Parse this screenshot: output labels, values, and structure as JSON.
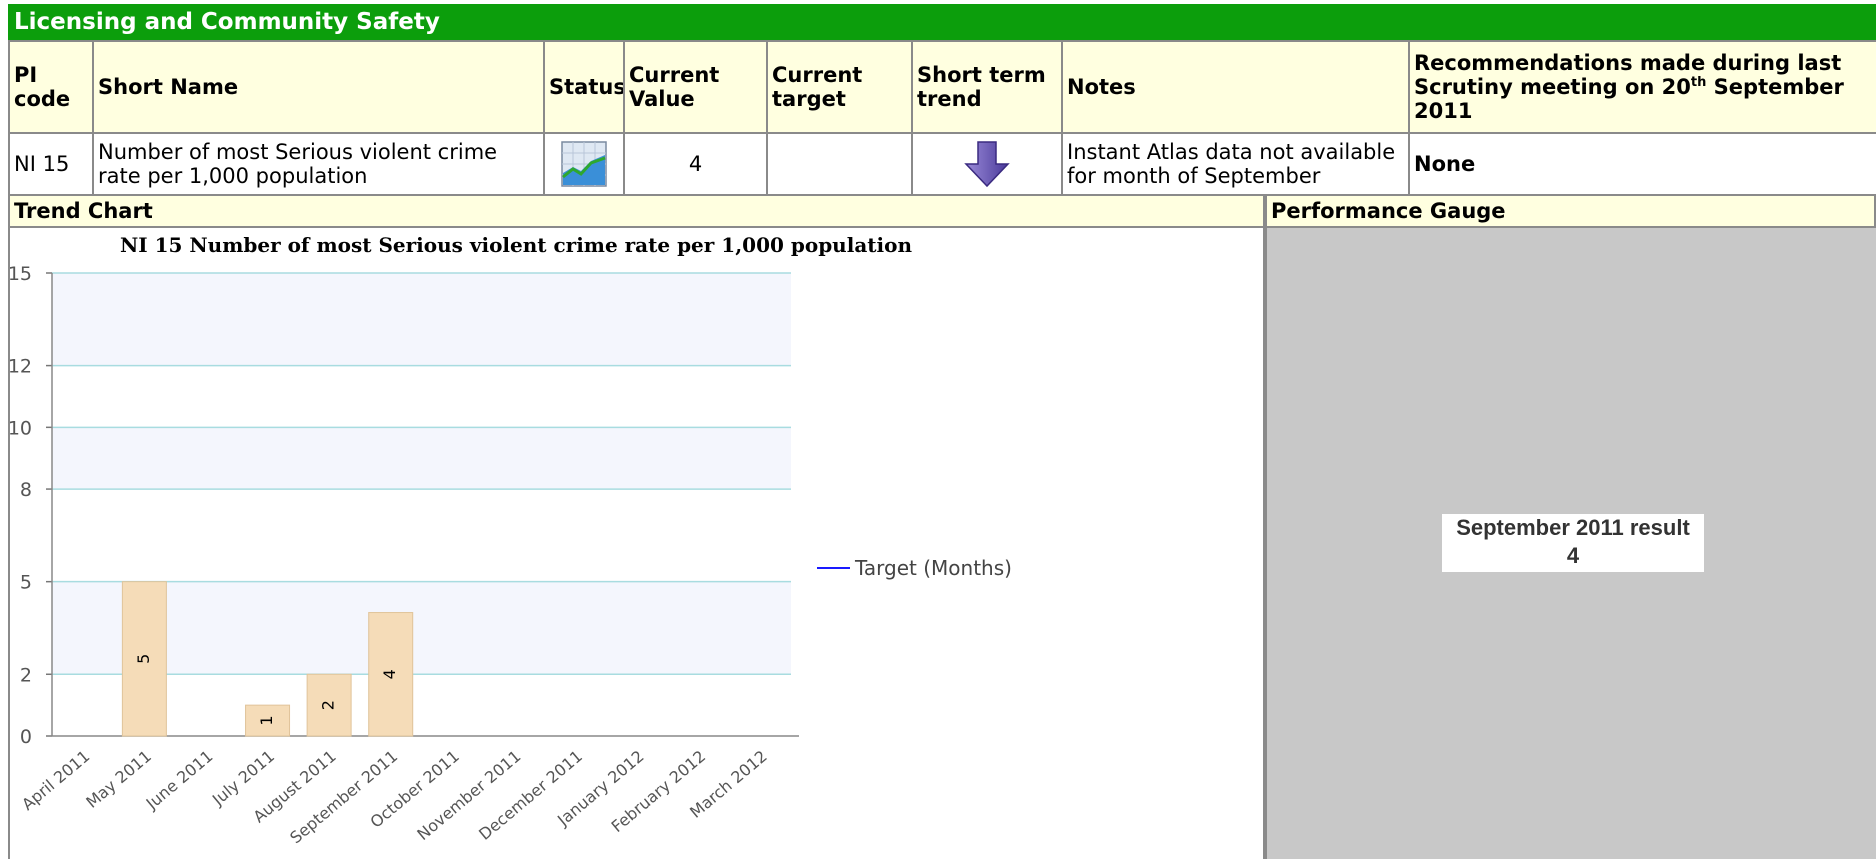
{
  "title": "Licensing and Community Safety",
  "headers": {
    "pi_code": "PI code",
    "short_name": "Short Name",
    "status": "Status",
    "current_value": "Current Value",
    "current_target": "Current target",
    "short_term_trend": "Short term trend",
    "notes": "Notes",
    "recommendations_pre": "Recommendations made during last Scrutiny meeting on 20",
    "recommendations_sup": "th",
    "recommendations_post": " September 2011"
  },
  "row": {
    "pi_code": "NI 15",
    "short_name": "Number of most Serious violent crime rate per 1,000 population",
    "status_icon": "chart-status-icon",
    "current_value": "4",
    "current_target": "",
    "trend_icon": "arrow-down-icon",
    "notes": "Instant Atlas data not available for month of September",
    "recommendations": "None"
  },
  "sections": {
    "trend_chart": "Trend Chart",
    "performance_gauge": "Performance Gauge"
  },
  "gauge": {
    "label": "September 2011 result",
    "value": "4"
  },
  "colors": {
    "title_bar": "#0c9e0c",
    "header_bg": "#ffffe0",
    "bar_fill": "#f5dcb8",
    "target_line": "#1a1aff",
    "gauge_bg": "#c8c8c8"
  },
  "chart_data": {
    "type": "bar",
    "title": "NI 15 Number of most Serious violent crime rate per 1,000 population",
    "categories": [
      "April 2011",
      "May 2011",
      "June 2011",
      "July 2011",
      "August 2011",
      "September 2011",
      "October 2011",
      "November 2011",
      "December 2011",
      "January 2012",
      "February 2012",
      "March 2012"
    ],
    "values": [
      null,
      5,
      null,
      1,
      2,
      4,
      null,
      null,
      null,
      null,
      null,
      null
    ],
    "yticks": [
      "0",
      "2",
      "5",
      "8",
      "10",
      "12",
      "15"
    ],
    "ylim": [
      0,
      15
    ],
    "legend": [
      "Target (Months)"
    ],
    "legend_position": "right",
    "grid": true
  }
}
